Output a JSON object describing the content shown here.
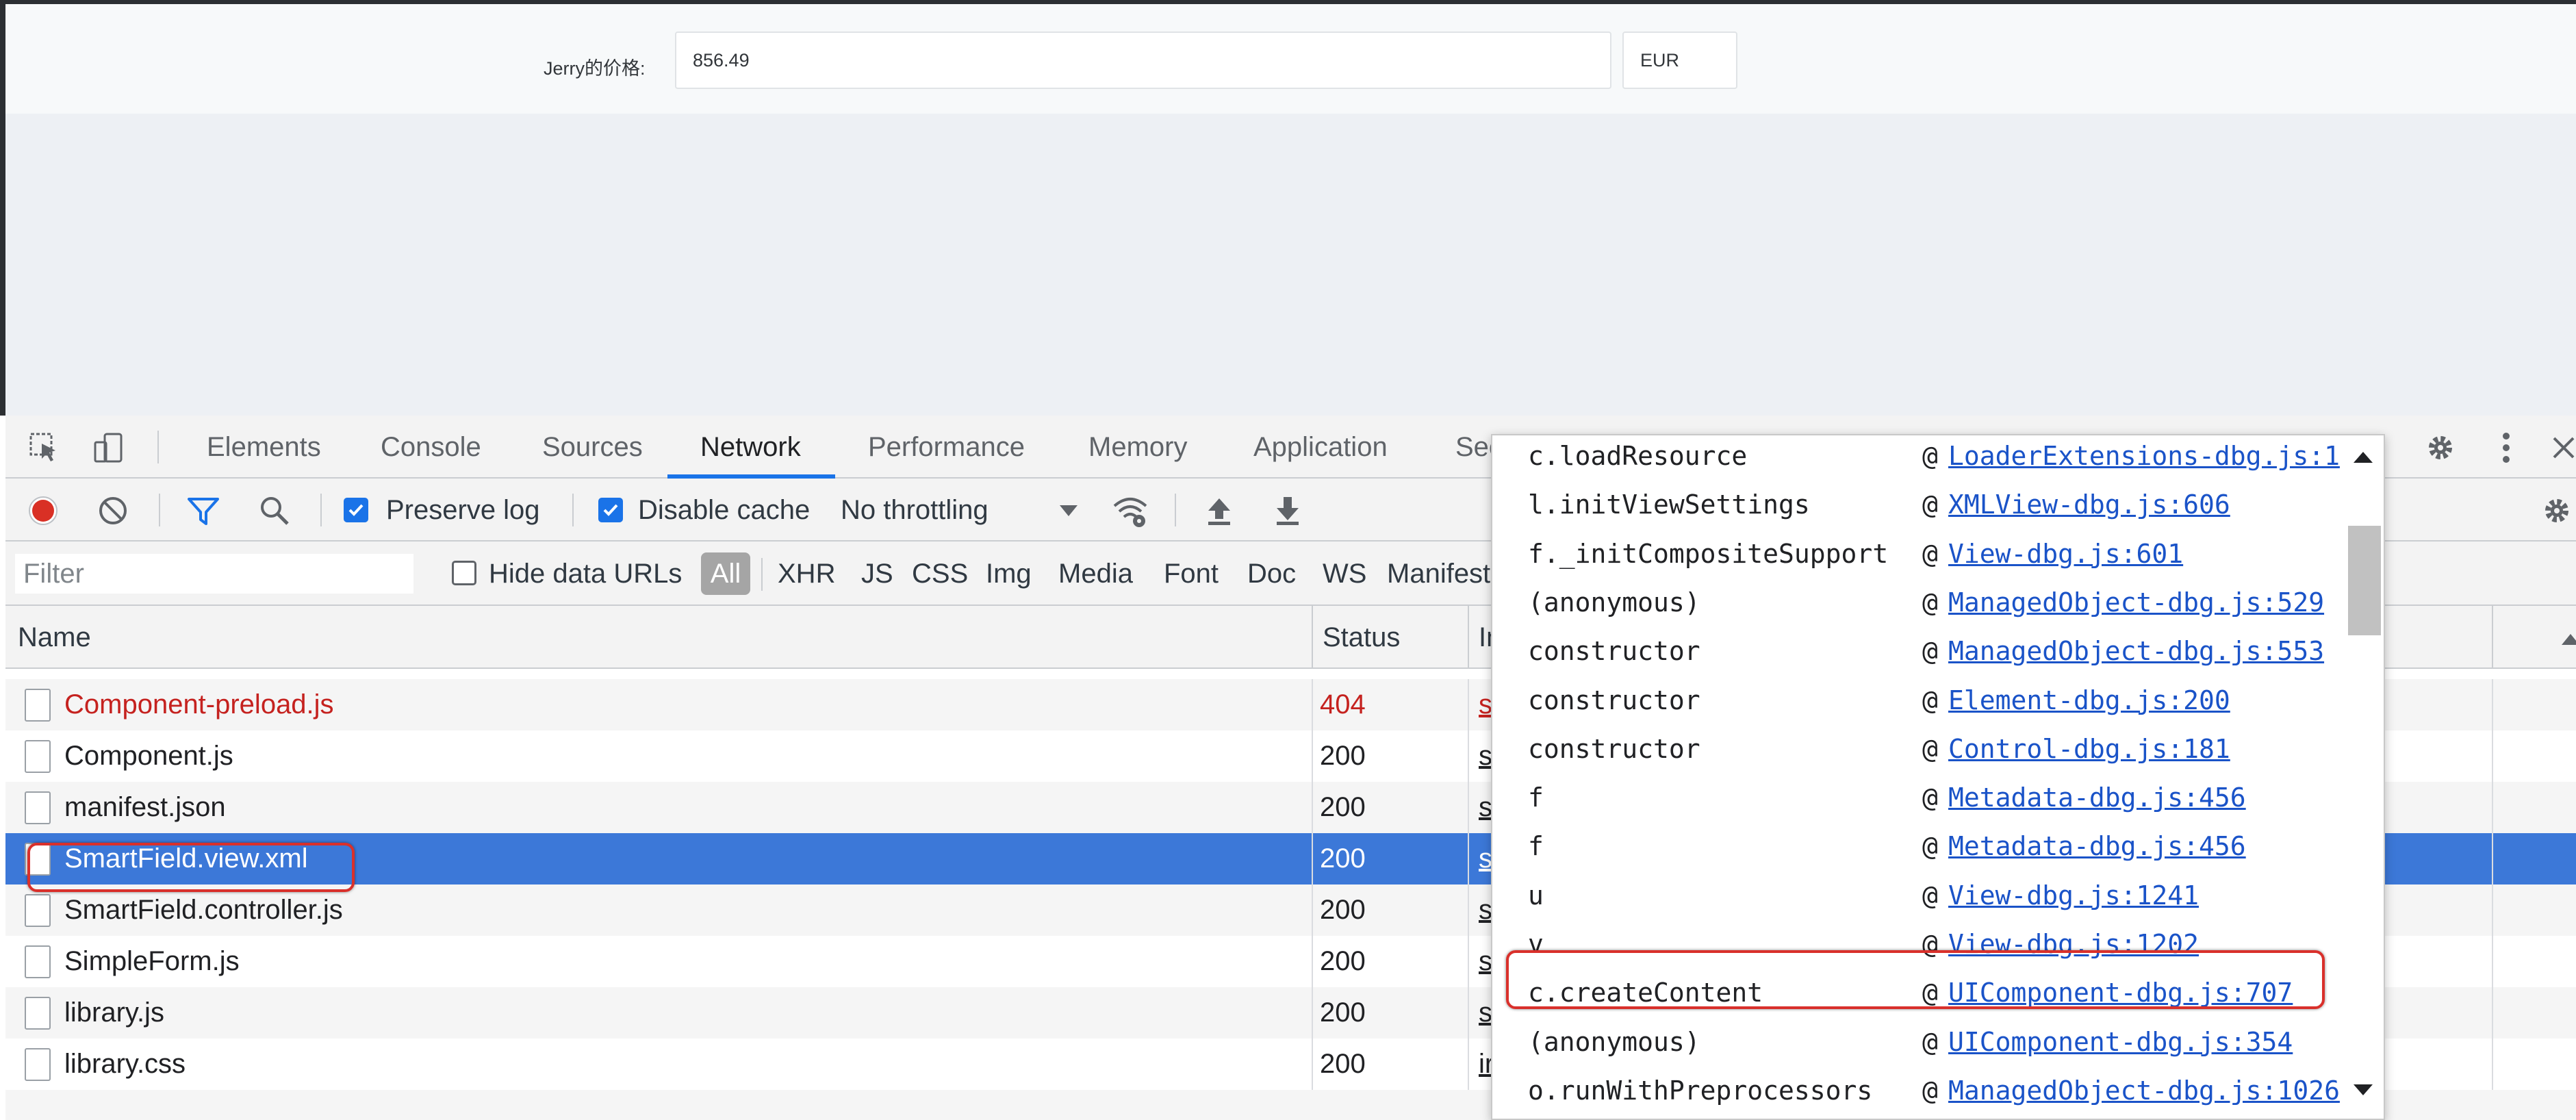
{
  "page": {
    "price_label": "Jerry的价格:",
    "price_value": "856.49",
    "currency_value": "EUR"
  },
  "devtools": {
    "tabs": [
      "Elements",
      "Console",
      "Sources",
      "Network",
      "Performance",
      "Memory",
      "Application",
      "Sec"
    ],
    "active_tab": "Network",
    "toolbar": {
      "preserve_log": "Preserve log",
      "disable_cache": "Disable cache",
      "throttling": "No throttling"
    },
    "filter": {
      "placeholder": "Filter",
      "hide_data_urls": "Hide data URLs",
      "types": [
        "All",
        "XHR",
        "JS",
        "CSS",
        "Img",
        "Media",
        "Font",
        "Doc",
        "WS",
        "Manifest"
      ]
    },
    "table": {
      "headers": {
        "name": "Name",
        "status": "Status",
        "initiator": "In"
      },
      "rows": [
        {
          "name": "Component-preload.js",
          "status": "404",
          "initiator": "s",
          "state": "error"
        },
        {
          "name": "Component.js",
          "status": "200",
          "initiator": "s",
          "state": "normal"
        },
        {
          "name": "manifest.json",
          "status": "200",
          "initiator": "s",
          "state": "normal"
        },
        {
          "name": "SmartField.view.xml",
          "status": "200",
          "initiator": "s",
          "state": "selected"
        },
        {
          "name": "SmartField.controller.js",
          "status": "200",
          "initiator": "s",
          "state": "normal"
        },
        {
          "name": "SimpleForm.js",
          "status": "200",
          "initiator": "s",
          "state": "normal"
        },
        {
          "name": "library.js",
          "status": "200",
          "initiator": "s",
          "state": "normal"
        },
        {
          "name": "library.css",
          "status": "200",
          "initiator": "ir",
          "state": "normal"
        }
      ]
    },
    "call_stack": [
      {
        "fn": "c.loadResource",
        "loc": "LoaderExtensions-dbg.js:1"
      },
      {
        "fn": "l.initViewSettings",
        "loc": "XMLView-dbg.js:606"
      },
      {
        "fn": "f._initCompositeSupport",
        "loc": "View-dbg.js:601"
      },
      {
        "fn": "(anonymous)",
        "loc": "ManagedObject-dbg.js:529"
      },
      {
        "fn": "constructor",
        "loc": "ManagedObject-dbg.js:553"
      },
      {
        "fn": "constructor",
        "loc": "Element-dbg.js:200"
      },
      {
        "fn": "constructor",
        "loc": "Control-dbg.js:181"
      },
      {
        "fn": "f",
        "loc": "Metadata-dbg.js:456"
      },
      {
        "fn": "f",
        "loc": "Metadata-dbg.js:456"
      },
      {
        "fn": "u",
        "loc": "View-dbg.js:1241"
      },
      {
        "fn": "v",
        "loc": "View-dbg.js:1202"
      },
      {
        "fn": "c.createContent",
        "loc": "UIComponent-dbg.js:707"
      },
      {
        "fn": "(anonymous)",
        "loc": "UIComponent-dbg.js:354"
      },
      {
        "fn": "o.runWithPreprocessors",
        "loc": "ManagedObject-dbg.js:1026"
      }
    ],
    "colors": {
      "accent": "#1a73e8",
      "selected_row": "#3c78d8",
      "error_text": "#c5221f",
      "highlight": "#d9302b"
    }
  }
}
